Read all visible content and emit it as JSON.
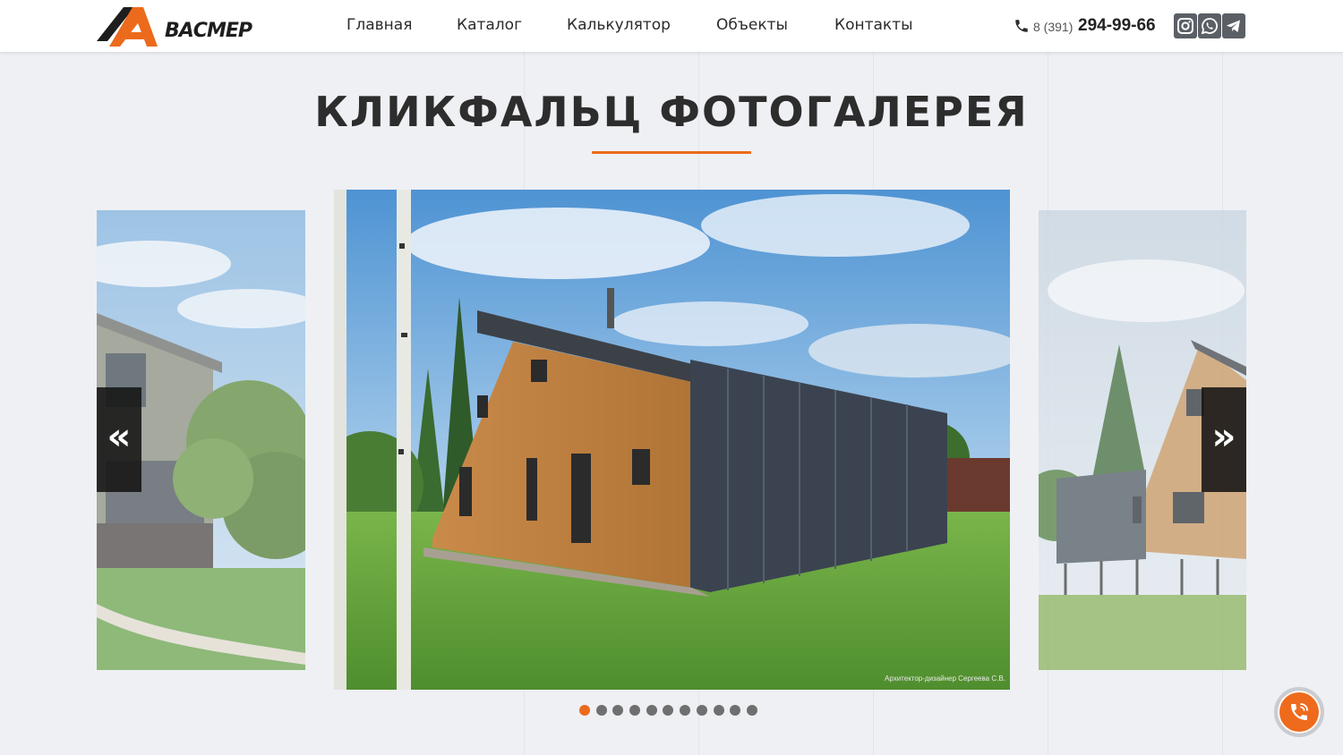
{
  "logo": {
    "text": "ВАСМЕР",
    "accent": "#ec6a1c"
  },
  "nav": {
    "items": [
      {
        "label": "Главная"
      },
      {
        "label": "Каталог"
      },
      {
        "label": "Калькулятор"
      },
      {
        "label": "Объекты"
      },
      {
        "label": "Контакты"
      }
    ]
  },
  "contact": {
    "phone_prefix": "8 (391)",
    "phone_number": "294-99-66",
    "phone_icon": "phone-icon",
    "social": [
      {
        "name": "instagram-icon"
      },
      {
        "name": "whatsapp-icon"
      },
      {
        "name": "telegram-icon"
      }
    ]
  },
  "gallery": {
    "title": "КЛИКФАЛЬЦ ФОТОГАЛЕРЕЯ",
    "prev_label": "«",
    "next_label": "»",
    "watermark": "Архитектор-дизайнер Сергеева С.В.",
    "slides_count": 11,
    "active_index": 0
  },
  "colors": {
    "accent": "#ec6a1c",
    "background": "#eef0f4",
    "header": "#ffffff"
  },
  "callback": {
    "icon": "phone-call-icon"
  }
}
